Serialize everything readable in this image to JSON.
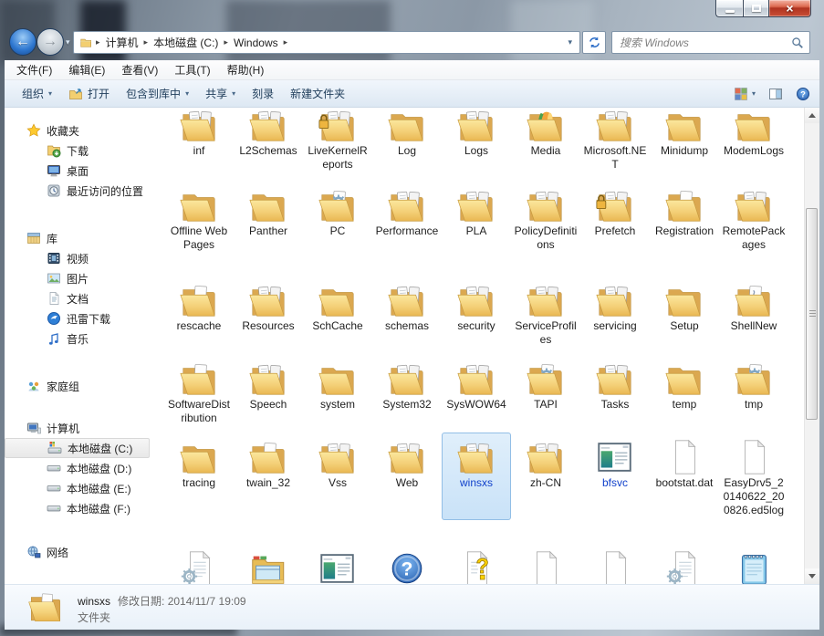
{
  "colors": {
    "selection_fill": "#c9e2f8",
    "selection_border": "#92bee6",
    "compressed_label": "#1141cb",
    "folder_yellow": "#f2cb70",
    "close_red": "#b03320",
    "toolbar_text": "#1e3c5a"
  },
  "titlebar": {
    "controls": [
      "minimize",
      "maximize",
      "close"
    ]
  },
  "navbar": {
    "breadcrumb": [
      "计算机",
      "本地磁盘 (C:)",
      "Windows"
    ],
    "search_placeholder": "搜索 Windows",
    "icons": [
      "back-icon",
      "forward-icon",
      "recent-pages-chevron",
      "address-folder-icon",
      "address-dropdown-icon",
      "refresh-icon",
      "search-magnifier-icon"
    ]
  },
  "menubar": {
    "items": [
      "文件(F)",
      "编辑(E)",
      "查看(V)",
      "工具(T)",
      "帮助(H)"
    ]
  },
  "toolbar": {
    "items": [
      {
        "label": "组织",
        "arrow": true,
        "icon": null
      },
      {
        "label": "打开",
        "arrow": false,
        "icon": "open-folder"
      },
      {
        "label": "包含到库中",
        "arrow": true,
        "icon": null
      },
      {
        "label": "共享",
        "arrow": true,
        "icon": null
      },
      {
        "label": "刻录",
        "arrow": false,
        "icon": null
      },
      {
        "label": "新建文件夹",
        "arrow": false,
        "icon": null
      }
    ],
    "right_icons": [
      "views-icon",
      "preview-pane-icon",
      "help-icon"
    ]
  },
  "sidebar": {
    "sections": [
      {
        "label": "收藏夹",
        "icon": "star",
        "items": [
          {
            "label": "下载",
            "icon": "folder-down"
          },
          {
            "label": "桌面",
            "icon": "monitor"
          },
          {
            "label": "最近访问的位置",
            "icon": "recent"
          }
        ]
      },
      {
        "label": "库",
        "icon": "library",
        "items": [
          {
            "label": "视频",
            "icon": "film"
          },
          {
            "label": "图片",
            "icon": "picture"
          },
          {
            "label": "文档",
            "icon": "docpage"
          },
          {
            "label": "迅雷下载",
            "icon": "thunder"
          },
          {
            "label": "音乐",
            "icon": "music"
          }
        ]
      },
      {
        "label": "家庭组",
        "icon": "homegroup",
        "items": []
      },
      {
        "label": "计算机",
        "icon": "computer",
        "items": [
          {
            "label": "本地磁盘 (C:)",
            "icon": "disk-sys",
            "selected": true
          },
          {
            "label": "本地磁盘 (D:)",
            "icon": "disk"
          },
          {
            "label": "本地磁盘 (E:)",
            "icon": "disk"
          },
          {
            "label": "本地磁盘 (F:)",
            "icon": "disk"
          }
        ]
      },
      {
        "label": "网络",
        "icon": "network",
        "items": []
      }
    ]
  },
  "files": {
    "rows": [
      {
        "items": [
          {
            "label": "inf",
            "icon": "folder-docs"
          },
          {
            "label": "L2Schemas",
            "icon": "folder-docs"
          },
          {
            "label": "LiveKernelReports",
            "icon": "folder-lock"
          },
          {
            "label": "Log",
            "icon": "folder"
          },
          {
            "label": "Logs",
            "icon": "folder-docs"
          },
          {
            "label": "Media",
            "icon": "folder-media"
          },
          {
            "label": "Microsoft.NET",
            "icon": "folder-docs"
          },
          {
            "label": "Minidump",
            "icon": "folder"
          },
          {
            "label": "ModemLogs",
            "icon": "folder"
          }
        ]
      },
      {
        "items": [
          {
            "label": "Offline Web Pages",
            "icon": "folder"
          },
          {
            "label": "Panther",
            "icon": "folder"
          },
          {
            "label": "PC",
            "icon": "folder-gear"
          },
          {
            "label": "Performance",
            "icon": "folder-docs"
          },
          {
            "label": "PLA",
            "icon": "folder-docs"
          },
          {
            "label": "PolicyDefinitions",
            "icon": "folder-docs"
          },
          {
            "label": "Prefetch",
            "icon": "folder-lock"
          },
          {
            "label": "Registration",
            "icon": "folder-doc"
          },
          {
            "label": "RemotePackages",
            "icon": "folder-docs"
          }
        ]
      },
      {
        "items": [
          {
            "label": "rescache",
            "icon": "folder-doc"
          },
          {
            "label": "Resources",
            "icon": "folder-docs"
          },
          {
            "label": "SchCache",
            "icon": "folder"
          },
          {
            "label": "schemas",
            "icon": "folder-docs"
          },
          {
            "label": "security",
            "icon": "folder-docs"
          },
          {
            "label": "ServiceProfiles",
            "icon": "folder-docs"
          },
          {
            "label": "servicing",
            "icon": "folder-docs"
          },
          {
            "label": "Setup",
            "icon": "folder"
          },
          {
            "label": "ShellNew",
            "icon": "folder-script"
          }
        ]
      },
      {
        "items": [
          {
            "label": "SoftwareDistribution",
            "icon": "folder-doc"
          },
          {
            "label": "Speech",
            "icon": "folder-docs"
          },
          {
            "label": "system",
            "icon": "folder"
          },
          {
            "label": "System32",
            "icon": "folder-docs"
          },
          {
            "label": "SysWOW64",
            "icon": "folder-docs"
          },
          {
            "label": "TAPI",
            "icon": "folder-gear"
          },
          {
            "label": "Tasks",
            "icon": "folder-docs"
          },
          {
            "label": "temp",
            "icon": "folder"
          },
          {
            "label": "tmp",
            "icon": "folder-gear"
          }
        ]
      },
      {
        "items": [
          {
            "label": "tracing",
            "icon": "folder"
          },
          {
            "label": "twain_32",
            "icon": "folder-doc"
          },
          {
            "label": "Vss",
            "icon": "folder-docs"
          },
          {
            "label": "Web",
            "icon": "folder-docs"
          },
          {
            "label": "winsxs",
            "icon": "folder-docs",
            "selected": true,
            "compressed": true
          },
          {
            "label": "zh-CN",
            "icon": "folder-docs"
          },
          {
            "label": "bfsvc",
            "icon": "app-window",
            "compressed": true
          },
          {
            "label": "bootstat.dat",
            "icon": "doc"
          },
          {
            "label": "EasyDrv5_20140622_200826.ed5log",
            "icon": "doc"
          }
        ]
      },
      {
        "items": [
          {
            "icon": "doc-gear"
          },
          {
            "icon": "app-folder"
          },
          {
            "icon": "app-window"
          },
          {
            "icon": "help"
          },
          {
            "icon": "doc-help"
          },
          {
            "icon": "doc"
          },
          {
            "icon": "doc"
          },
          {
            "icon": "doc-gear"
          },
          {
            "icon": "notepad"
          }
        ]
      }
    ]
  },
  "details": {
    "name": "winsxs",
    "modified_label": "修改日期:",
    "modified_value": "2014/11/7 19:09",
    "type": "文件夹"
  }
}
